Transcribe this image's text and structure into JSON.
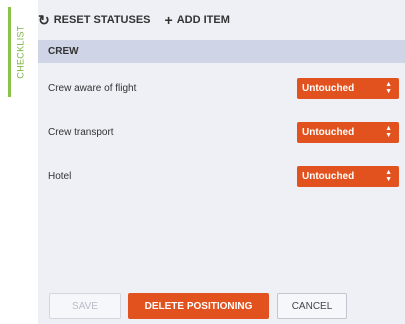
{
  "side_tab": {
    "label": "CHECKLIST"
  },
  "toolbar": {
    "reset_label": "RESET STATUSES",
    "add_label": "ADD ITEM"
  },
  "section": {
    "title": "CREW"
  },
  "items": [
    {
      "label": "Crew aware of flight",
      "status": "Untouched"
    },
    {
      "label": "Crew transport",
      "status": "Untouched"
    },
    {
      "label": "Hotel",
      "status": "Untouched"
    }
  ],
  "footer": {
    "save_label": "SAVE",
    "delete_label": "DELETE POSITIONING",
    "cancel_label": "CANCEL"
  },
  "colors": {
    "accent_orange": "#e2521e",
    "tab_green": "#8bc34a",
    "panel_bg": "#eef0f6",
    "section_bg": "#cfd4e6"
  }
}
